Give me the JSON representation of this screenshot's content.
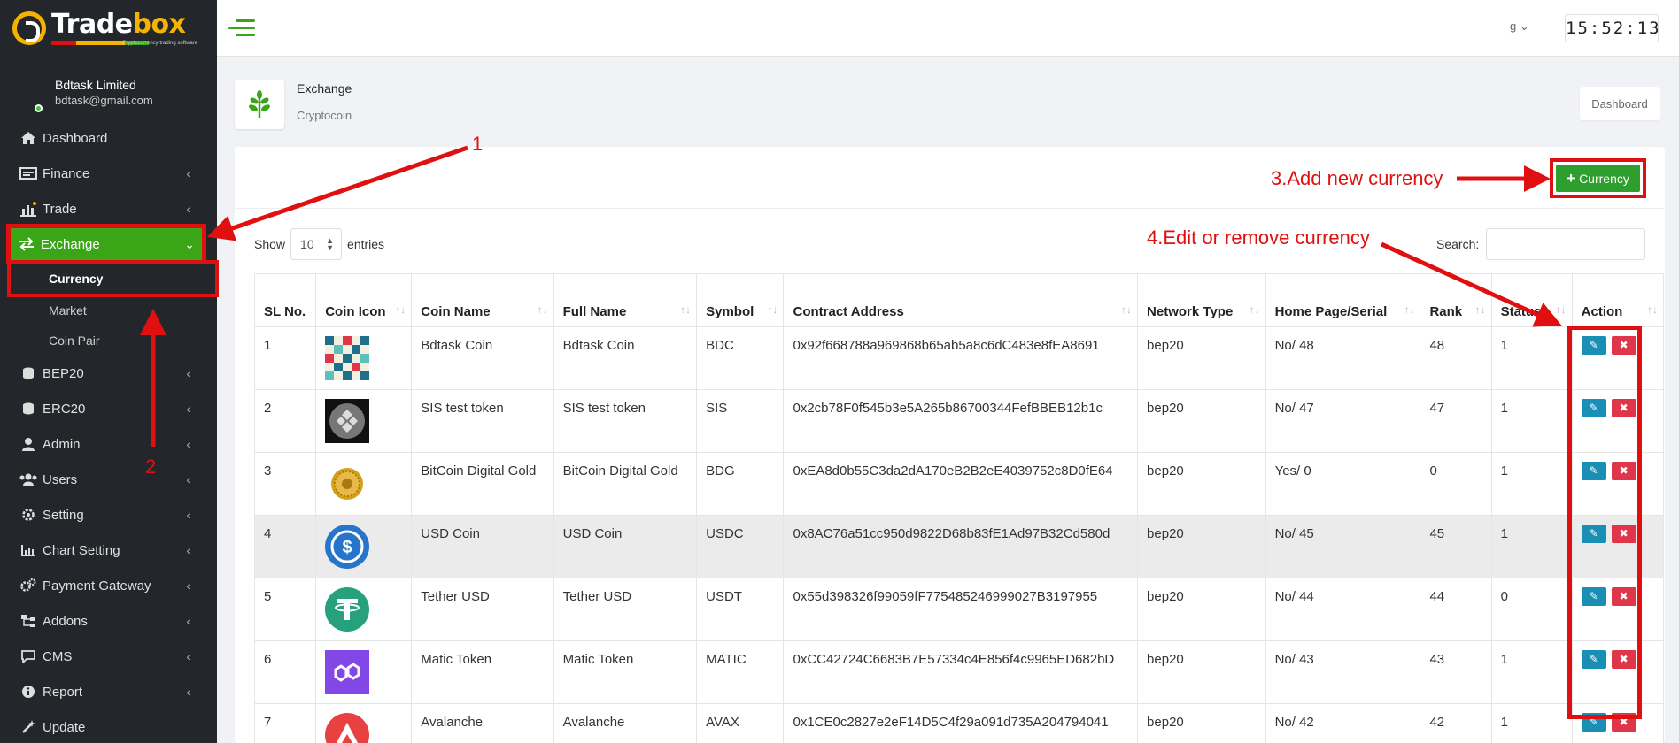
{
  "brand": {
    "name_part1": "Trade",
    "name_part2": "box",
    "tagline": "Cryptocurrency trading software"
  },
  "profile": {
    "name": "Bdtask Limited",
    "email": "bdtask@gmail.com"
  },
  "sidebar": {
    "items": [
      {
        "label": "Dashboard",
        "icon": "home-icon"
      },
      {
        "label": "Finance",
        "icon": "money-icon"
      },
      {
        "label": "Trade",
        "icon": "chart-icon"
      },
      {
        "label": "Exchange",
        "icon": "exchange-icon"
      },
      {
        "label": "BEP20",
        "icon": "coins-icon"
      },
      {
        "label": "ERC20",
        "icon": "coins-icon"
      },
      {
        "label": "Admin",
        "icon": "user-icon"
      },
      {
        "label": "Users",
        "icon": "users-icon"
      },
      {
        "label": "Setting",
        "icon": "gear-icon"
      },
      {
        "label": "Chart Setting",
        "icon": "bar-chart-icon"
      },
      {
        "label": "Payment Gateway",
        "icon": "gear-icon"
      },
      {
        "label": "Addons",
        "icon": "sitemap-icon"
      },
      {
        "label": "CMS",
        "icon": "comment-icon"
      },
      {
        "label": "Report",
        "icon": "info-icon"
      },
      {
        "label": "Update",
        "icon": "magic-icon"
      }
    ],
    "exchange_sub": [
      "Currency",
      "Market",
      "Coin Pair"
    ]
  },
  "topbar": {
    "lang": "g",
    "clock": "15:52:13"
  },
  "page": {
    "title": "Exchange",
    "subtitle": "Cryptocoin",
    "breadcrumb": "Dashboard"
  },
  "toolbar": {
    "add_label": "Currency"
  },
  "list": {
    "show": "Show",
    "entries_value": "10",
    "entries": "entries",
    "search_label": "Search:"
  },
  "table": {
    "headers": [
      "SL No.",
      "Coin Icon",
      "Coin Name",
      "Full Name",
      "Symbol",
      "Contract Address",
      "Network Type",
      "Home Page/Serial",
      "Rank",
      "Status",
      "Action"
    ],
    "rows": [
      {
        "sl": "1",
        "icon": "bdtask",
        "name": "Bdtask Coin",
        "full": "Bdtask Coin",
        "symbol": "BDC",
        "address": "0x92f668788a969868b65ab5a8c6dC483e8fEA8691",
        "network": "bep20",
        "home": "No/ 48",
        "rank": "48",
        "status": "1"
      },
      {
        "sl": "2",
        "icon": "sis",
        "name": "SIS test token",
        "full": "SIS test token",
        "symbol": "SIS",
        "address": "0x2cb78F0f545b3e5A265b86700344FefBBEB12b1c",
        "network": "bep20",
        "home": "No/ 47",
        "rank": "47",
        "status": "1"
      },
      {
        "sl": "3",
        "icon": "bdg",
        "name": "BitCoin Digital Gold",
        "full": "BitCoin Digital Gold",
        "symbol": "BDG",
        "address": "0xEA8d0b55C3da2dA170eB2B2eE4039752c8D0fE64",
        "network": "bep20",
        "home": "Yes/ 0",
        "rank": "0",
        "status": "1"
      },
      {
        "sl": "4",
        "icon": "usdc",
        "name": "USD Coin",
        "full": "USD Coin",
        "symbol": "USDC",
        "address": "0x8AC76a51cc950d9822D68b83fE1Ad97B32Cd580d",
        "network": "bep20",
        "home": "No/ 45",
        "rank": "45",
        "status": "1"
      },
      {
        "sl": "5",
        "icon": "usdt",
        "name": "Tether USD",
        "full": "Tether USD",
        "symbol": "USDT",
        "address": "0x55d398326f99059fF775485246999027B3197955",
        "network": "bep20",
        "home": "No/ 44",
        "rank": "44",
        "status": "0"
      },
      {
        "sl": "6",
        "icon": "matic",
        "name": "Matic Token",
        "full": "Matic Token",
        "symbol": "MATIC",
        "address": "0xCC42724C6683B7E57334c4E856f4c9965ED682bD",
        "network": "bep20",
        "home": "No/ 43",
        "rank": "43",
        "status": "1"
      },
      {
        "sl": "7",
        "icon": "avax",
        "name": "Avalanche",
        "full": "Avalanche",
        "symbol": "AVAX",
        "address": "0x1CE0c2827e2eF14D5C4f29a091d735A204794041",
        "network": "bep20",
        "home": "No/ 42",
        "rank": "42",
        "status": "1"
      }
    ]
  },
  "annotations": {
    "a1": "1",
    "a2": "2",
    "a3": "3.Add new currency",
    "a4": "4.Edit or remove currency"
  },
  "colors": {
    "accent": "#3aa517",
    "sidebar": "#23272b",
    "annotation": "#e01010",
    "edit": "#1a8fb6",
    "delete": "#e0364a"
  }
}
